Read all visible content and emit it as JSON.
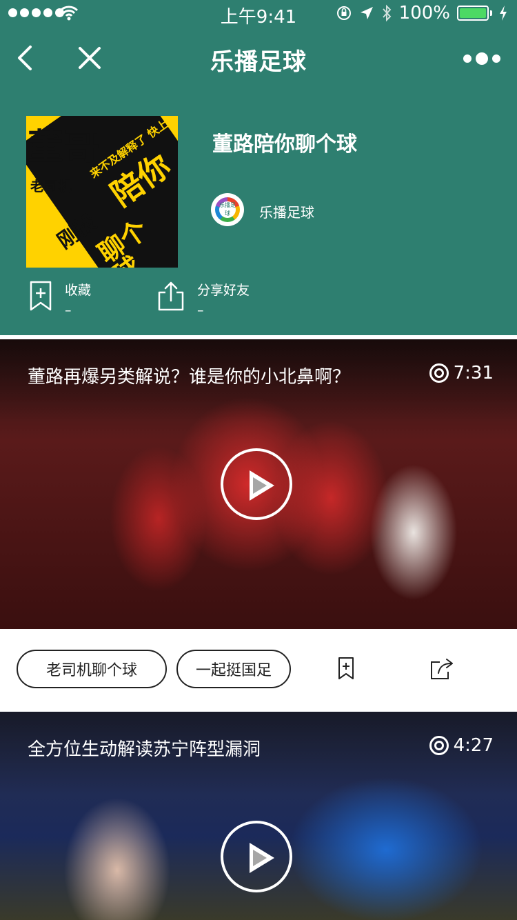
{
  "status_bar": {
    "time": "上午9:41",
    "battery": "100%"
  },
  "nav": {
    "title": "乐播足球"
  },
  "header": {
    "title": "董路陪你聊个球",
    "author": "乐播足球",
    "author_logo_text": "乐播足球",
    "cover_text": {
      "main": "董哥",
      "sub": "老司机",
      "side": "陪你",
      "side2": "聊个球",
      "corner": "刚毅",
      "top": "来不及解释了 快上车"
    },
    "actions": [
      {
        "label": "收藏",
        "count": "–"
      },
      {
        "label": "分享好友",
        "count": "–"
      }
    ]
  },
  "videos": [
    {
      "title": "董路再爆另类解说？谁是你的小北鼻啊？",
      "duration": "7:31"
    },
    {
      "title": "全方位生动解读苏宁阵型漏洞",
      "duration": "4:27"
    }
  ],
  "tags": [
    "老司机聊个球",
    "一起挺国足"
  ]
}
